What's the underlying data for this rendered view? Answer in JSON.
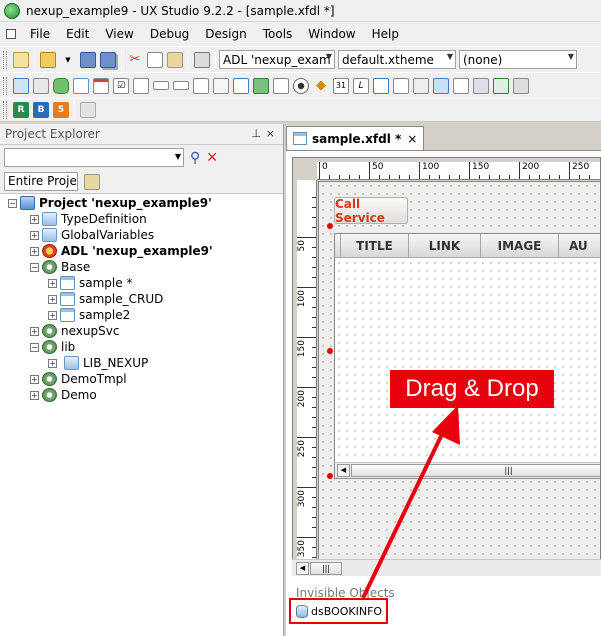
{
  "window": {
    "title": "nexup_example9 - UX Studio 9.2.2 - [sample.xfdl *]"
  },
  "menu": [
    "File",
    "Edit",
    "View",
    "Debug",
    "Design",
    "Tools",
    "Window",
    "Help"
  ],
  "toolbar": {
    "adl_combo": "ADL 'nexup_exam",
    "theme_combo": "default.xtheme",
    "none_combo": "(none)"
  },
  "explorer": {
    "title": "Project Explorer",
    "pin": "⊥",
    "close": "×",
    "scope": "Entire Proje",
    "tree": [
      {
        "label": "Project 'nexup_example9'",
        "bold": true
      },
      {
        "label": "TypeDefinition"
      },
      {
        "label": "GlobalVariables"
      },
      {
        "label": "ADL 'nexup_example9'",
        "bold": true
      },
      {
        "label": "Base"
      },
      {
        "label": "sample *"
      },
      {
        "label": "sample_CRUD"
      },
      {
        "label": "sample2"
      },
      {
        "label": "nexupSvc"
      },
      {
        "label": "lib"
      },
      {
        "label": "LIB_NEXUP"
      },
      {
        "label": "DemoTmpl"
      },
      {
        "label": "Demo"
      }
    ]
  },
  "editor": {
    "tab_label": "sample.xfdl *",
    "tab_close": "×",
    "ruler_h": [
      "0",
      "50",
      "100",
      "150",
      "200",
      "250"
    ],
    "ruler_v": [
      "50",
      "100",
      "150",
      "200",
      "250",
      "300",
      "350"
    ],
    "button_label": "Call Service",
    "grid_columns": [
      "TITLE",
      "LINK",
      "IMAGE",
      "AU"
    ],
    "invisible_label": "Invisible Objects",
    "dataset_label": "dsBOOKINFO"
  },
  "annotation": {
    "text": "Drag & Drop",
    "color": "#e8000f"
  }
}
